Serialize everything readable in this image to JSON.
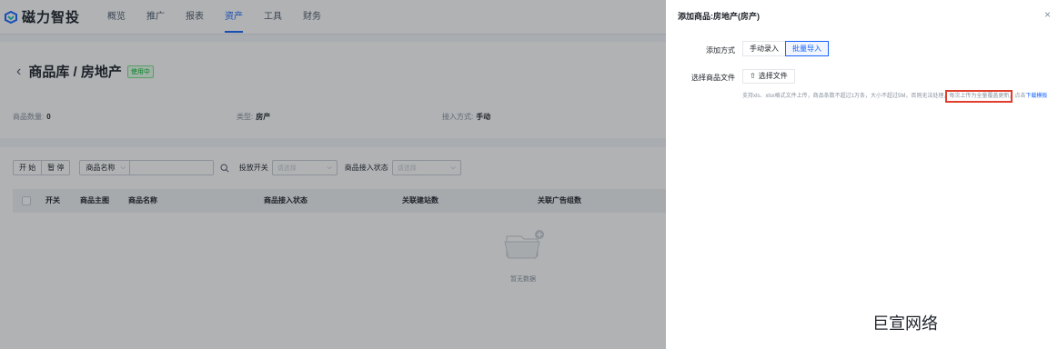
{
  "brand": {
    "name": "磁力智投",
    "accent": "#1664ff"
  },
  "nav": [
    {
      "label": "概览"
    },
    {
      "label": "推广"
    },
    {
      "label": "报表"
    },
    {
      "label": "资产"
    },
    {
      "label": "工具"
    },
    {
      "label": "财务"
    }
  ],
  "page": {
    "back_icon": "chevron-left",
    "title": "商品库 / 房地产",
    "status": "使用中",
    "meta": {
      "count_label": "商品数量:",
      "count_value": "0",
      "type_label": "类型:",
      "type_value": "房产",
      "access_label": "接入方式:",
      "access_value": "手动"
    }
  },
  "filters": {
    "start": "开 始",
    "pause": "暂 停",
    "field_select": "商品名称",
    "delivery_switch_label": "投放开关",
    "delivery_switch_placeholder": "请选择",
    "access_status_label": "商品接入状态",
    "access_status_placeholder": "请选择"
  },
  "table": {
    "columns": [
      "开关",
      "商品主图",
      "商品名称",
      "商品接入状态",
      "关联建站数",
      "关联广告组数"
    ],
    "rows": [],
    "empty_text": "暂无数据"
  },
  "drawer": {
    "title": "添加商品:房地产(房产)",
    "mode_label": "添加方式",
    "mode_options": [
      "手动录入",
      "批量导入"
    ],
    "mode_selected": "批量导入",
    "file_label": "选择商品文件",
    "upload_button": "选择文件",
    "hint_before": "支持xls、xlsx格式文件上传，商品条数不超过1万条，大小不超过5M，否则无法处理，",
    "hint_highlight": "每次上传为全量覆盖更新",
    "hint_after": "，点击",
    "hint_link": "下载模板",
    "highlight_color": "#e03e2d"
  },
  "watermark": "巨宣网络"
}
